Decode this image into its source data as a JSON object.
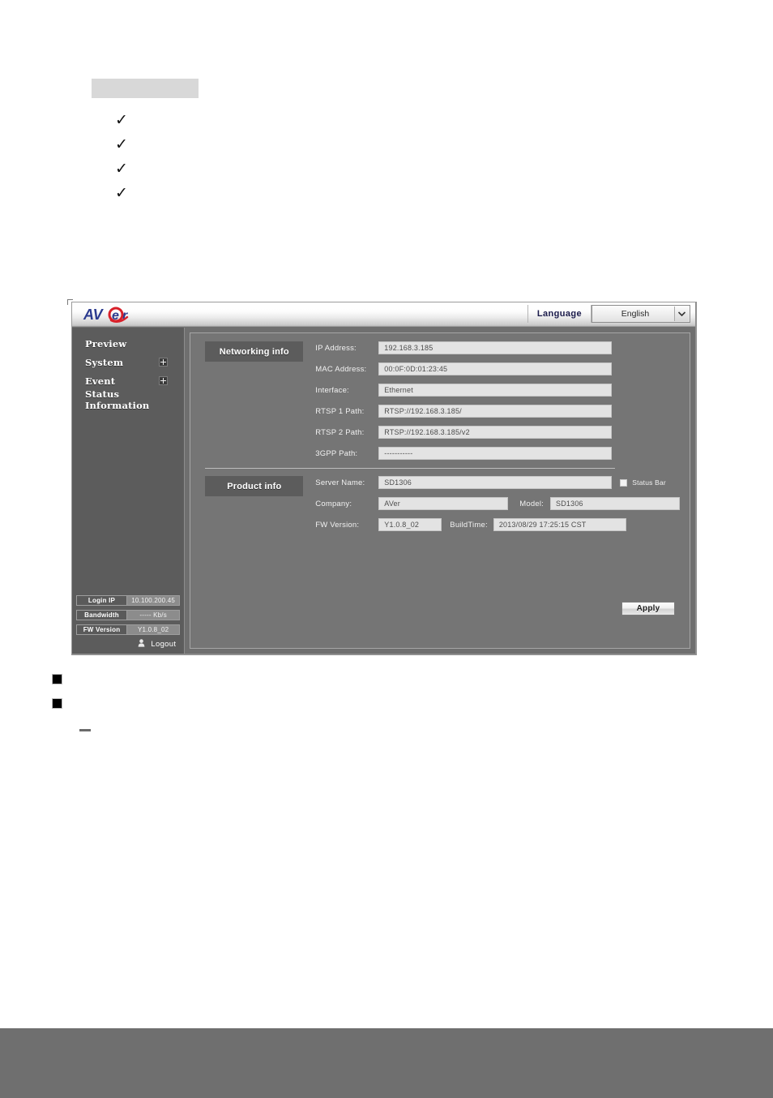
{
  "app": {
    "logo_text": "AVer",
    "language": {
      "label": "Language",
      "selected": "English"
    }
  },
  "sidebar": {
    "items": [
      {
        "label": "Preview",
        "expandable": false
      },
      {
        "label": "System",
        "expandable": true
      },
      {
        "label": "Event",
        "expandable": true
      },
      {
        "label": "Status Information",
        "expandable": false
      }
    ],
    "status": [
      {
        "key": "Login IP",
        "value": "10.100.200.45"
      },
      {
        "key": "Bandwidth",
        "value": "----- Kb/s"
      },
      {
        "key": "FW Version",
        "value": "Y1.0.8_02"
      }
    ],
    "logout_label": "Logout"
  },
  "main": {
    "networking": {
      "badge": "Networking info",
      "fields": [
        {
          "label": "IP Address:",
          "value": "192.168.3.185"
        },
        {
          "label": "MAC Address:",
          "value": "00:0F:0D:01:23:45"
        },
        {
          "label": "Interface:",
          "value": "Ethernet"
        },
        {
          "label": "RTSP 1 Path:",
          "value": "RTSP://192.168.3.185/"
        },
        {
          "label": "RTSP 2 Path:",
          "value": "RTSP://192.168.3.185/v2"
        },
        {
          "label": "3GPP Path:",
          "value": "-----------"
        }
      ]
    },
    "product": {
      "badge": "Product info",
      "server_name_label": "Server Name:",
      "server_name_value": "SD1306",
      "status_bar_label": "Status Bar",
      "status_bar_checked": false,
      "company_label": "Company:",
      "company_value": "AVer",
      "model_label": "Model:",
      "model_value": "SD1306",
      "fw_version_label": "FW Version:",
      "fw_version_value": "Y1.0.8_02",
      "build_time_label": "BuildTime:",
      "build_time_value": "2013/08/29 17:25:15 CST"
    },
    "apply_label": "Apply"
  },
  "colors": {
    "window_bg": "#6f6f6f",
    "sidebar_bg": "#5c5c5c",
    "panel_bg": "#757575",
    "badge_bg": "#5c5c5c",
    "field_bg": "#e3e3e3",
    "logo_blue": "#2b3a8f",
    "logo_red": "#d8202a",
    "footer_band": "#6f6f6f"
  }
}
